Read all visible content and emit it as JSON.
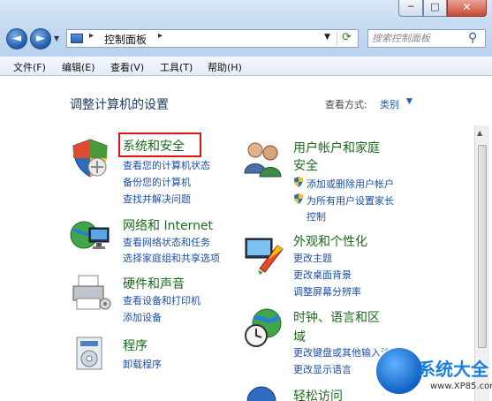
{
  "titlebar": {
    "min_glyph": "─",
    "max_glyph": "□",
    "close_glyph": "✕"
  },
  "address": {
    "back_glyph": "◄",
    "forward_glyph": "►",
    "crumb": "控制面板",
    "search_placeholder": "搜索控制面板"
  },
  "menu": [
    "文件(F)",
    "编辑(E)",
    "查看(V)",
    "工具(T)",
    "帮助(H)"
  ],
  "page_title": "调整计算机的设置",
  "view": {
    "label": "查看方式:",
    "value": "类别"
  },
  "left": [
    {
      "title": "系统和安全",
      "links": [
        "查看您的计算机状态",
        "备份您的计算机",
        "查找并解决问题"
      ],
      "icon": "shield-security-icon"
    },
    {
      "title": "网络和 Internet",
      "links": [
        "查看网络状态和任务",
        "选择家庭组和共享选项"
      ],
      "icon": "network-globe-icon"
    },
    {
      "title": "硬件和声音",
      "links": [
        "查看设备和打印机",
        "添加设备"
      ],
      "icon": "printer-icon"
    },
    {
      "title": "程序",
      "links": [
        "卸载程序"
      ],
      "icon": "programs-icon"
    }
  ],
  "right": [
    {
      "title_line1": "用户帐户和家庭",
      "title_line2": "安全",
      "links": [
        "添加或删除用户帐户",
        "为所有用户设置家长",
        "控制"
      ],
      "icon": "user-accounts-icon"
    },
    {
      "title": "外观和个性化",
      "links": [
        "更改主题",
        "更改桌面背景",
        "调整屏幕分辨率"
      ],
      "icon": "personalization-icon"
    },
    {
      "title_line1": "时钟、语言和区",
      "title_line2": "域",
      "links": [
        "更改键盘或其他输入法",
        "更改显示语言"
      ],
      "icon": "clock-globe-icon"
    },
    {
      "title": "轻松访问"
    }
  ],
  "watermark": {
    "brand": "系统大全",
    "url": "www.XP85.com"
  },
  "colors": {
    "section_title": "#1a6b1a",
    "link": "#1c4fa8",
    "highlight_box": "#e01414"
  }
}
